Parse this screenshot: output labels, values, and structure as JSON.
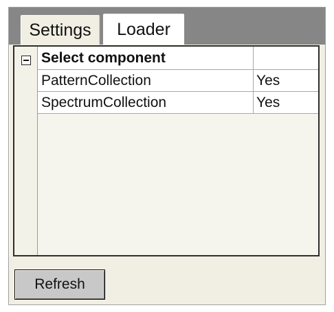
{
  "tabs": [
    {
      "label": "Settings",
      "selected": false
    },
    {
      "label": "Loader",
      "selected": true
    }
  ],
  "grid": {
    "category": {
      "label": "Select component",
      "value": "",
      "icon": "collapse-minus-icon",
      "expanded": true
    },
    "rows": [
      {
        "name": "PatternCollection",
        "value": "Yes"
      },
      {
        "name": "SpectrumCollection",
        "value": "Yes"
      }
    ]
  },
  "buttons": {
    "refresh_label": "Refresh"
  },
  "colors": {
    "panel_background": "#f1efe3",
    "tab_strip": "#8f8f8f",
    "grid_border": "#2d2d2d",
    "button_face": "#c8c8c8"
  }
}
